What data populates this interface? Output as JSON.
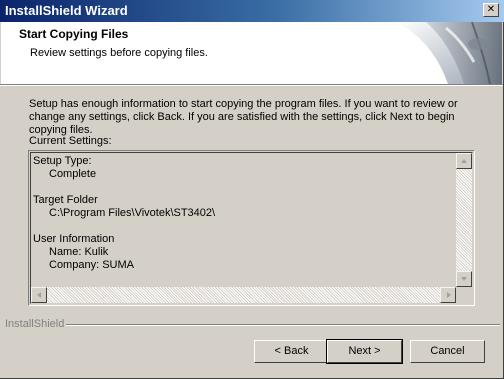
{
  "window": {
    "title": "InstallShield Wizard",
    "close_glyph": "✕"
  },
  "header": {
    "title": "Start Copying Files",
    "subtitle": "Review settings before copying files."
  },
  "body": {
    "intro": "Setup has enough information to start copying the program files.  If you want to review or change any settings, click Back.  If you are satisfied with the settings, click Next to begin copying files.",
    "settings_label": "Current Settings:"
  },
  "settings": {
    "setup_type_label": "Setup Type:",
    "setup_type_value": "Complete",
    "target_folder_label": "Target Folder",
    "target_folder_value": "C:\\Program Files\\Vivotek\\ST3402\\",
    "user_info_label": "User Information",
    "user_name": "Name: Kulik",
    "user_company": "Company: SUMA"
  },
  "footer": {
    "brand": "InstallShield"
  },
  "buttons": {
    "back": "< Back",
    "next": "Next >",
    "cancel": "Cancel"
  }
}
